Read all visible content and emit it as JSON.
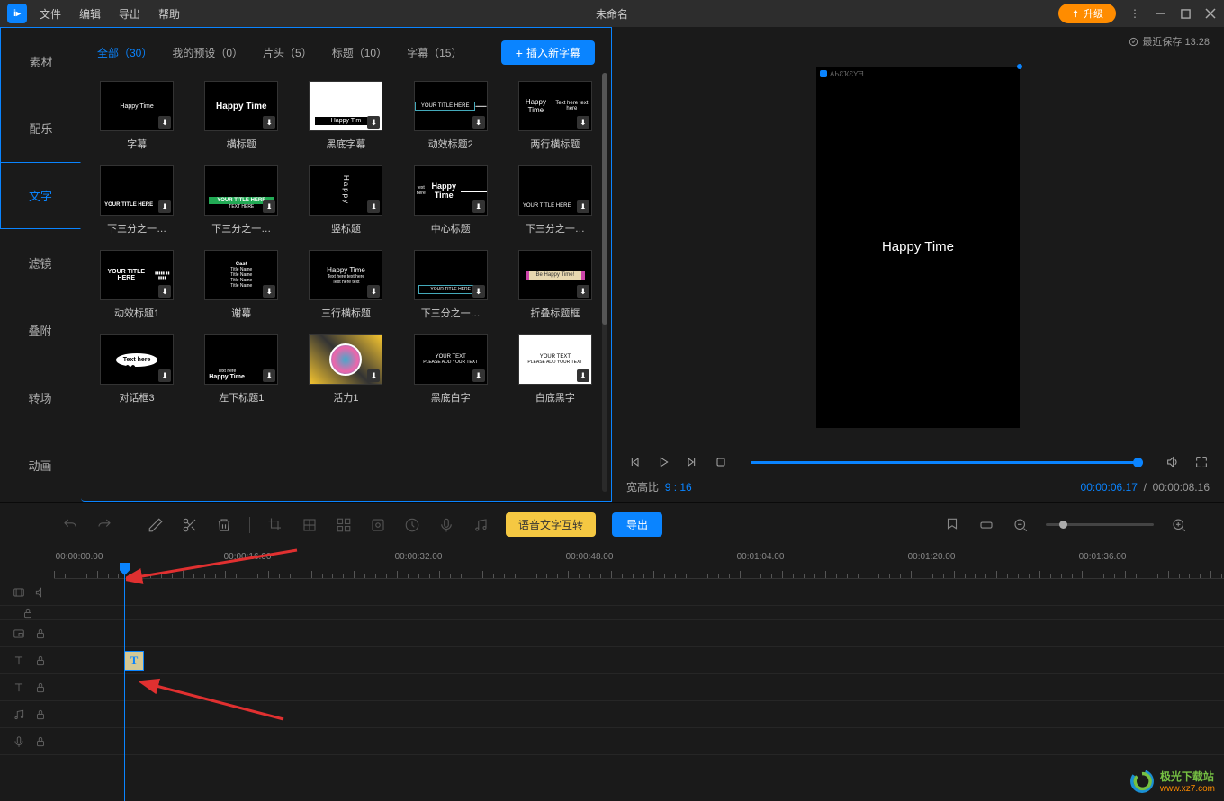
{
  "titlebar": {
    "menu": [
      "文件",
      "编辑",
      "导出",
      "帮助"
    ],
    "title": "未命名",
    "upgrade": "升级",
    "save_info": "最近保存 13:28"
  },
  "sidebar": {
    "items": [
      "素材",
      "配乐",
      "文字",
      "滤镜",
      "叠附",
      "转场",
      "动画"
    ],
    "active_index": 2
  },
  "tabs": {
    "items": [
      "全部（30）",
      "我的预设（0）",
      "片头（5）",
      "标题（10）",
      "字幕（15）"
    ],
    "active_index": 0,
    "insert_btn": "插入新字幕"
  },
  "templates": [
    {
      "label": "字幕",
      "preview": "Happy Time",
      "style": "caption"
    },
    {
      "label": "横标题",
      "preview": "Happy Time",
      "style": "htitle"
    },
    {
      "label": "黑底字幕",
      "preview": "Happy Time",
      "style": "white-bg-caption"
    },
    {
      "label": "动效标题2",
      "preview": "YOUR TITLE HERE",
      "style": "boxed"
    },
    {
      "label": "两行横标题",
      "preview": "Happy Time\nText here text here",
      "style": "two-line"
    },
    {
      "label": "下三分之一…",
      "preview": "YOUR TITLE HERE",
      "style": "lower-third"
    },
    {
      "label": "下三分之一…",
      "preview": "YOUR TITLE HERE",
      "style": "lower-third-green"
    },
    {
      "label": "竖标题",
      "preview": "Happy",
      "style": "vertical"
    },
    {
      "label": "中心标题",
      "preview": "Happy Time",
      "style": "center"
    },
    {
      "label": "下三分之一…",
      "preview": "YOUR TITLE HERE",
      "style": "lower-third2"
    },
    {
      "label": "动效标题1",
      "preview": "YOUR TITLE HERE",
      "style": "anim1"
    },
    {
      "label": "谢幕",
      "preview": "Cast\nTitle Name\nTitle Name\nTitle Name\nTitle Name",
      "style": "credits"
    },
    {
      "label": "三行横标题",
      "preview": "Happy Time\nText here text here\nText here text",
      "style": "three-line"
    },
    {
      "label": "下三分之一…",
      "preview": "YOUR TITLE HERE",
      "style": "lower-third3"
    },
    {
      "label": "折叠标题框",
      "preview": "Be Happy Time!",
      "style": "ribbon"
    },
    {
      "label": "对话框3",
      "preview": "Text here",
      "style": "speech"
    },
    {
      "label": "左下标题1",
      "preview": "Happy Time",
      "style": "bottom-left"
    },
    {
      "label": "活力1",
      "preview": "",
      "style": "vibrant"
    },
    {
      "label": "黑底白字",
      "preview": "YOUR TEXT\nPLEASE ADD YOUR TEXT",
      "style": "black-white"
    },
    {
      "label": "白底黑字",
      "preview": "YOUR TEXT\nPLEASE ADD YOUR TEXT",
      "style": "white-black"
    }
  ],
  "preview": {
    "text": "Happy Time",
    "watermark": "AЬƐҠƐƳƎ",
    "aspect_label": "宽高比",
    "aspect_value": "9 : 16",
    "current_time": "00:00:06.17",
    "total_time": "00:00:08.16"
  },
  "toolbar": {
    "voice_btn": "语音文字互转",
    "export_btn": "导出"
  },
  "timeline": {
    "start_label": "00:00:00.00",
    "ruler": [
      "00:00:16.00",
      "00:00:32.00",
      "00:00:48.00",
      "00:01:04.00",
      "00:01:20.00",
      "00:01:36.00"
    ],
    "clip_text": "T"
  },
  "watermark_site": {
    "name": "极光下载站",
    "url": "www.xz7.com"
  }
}
